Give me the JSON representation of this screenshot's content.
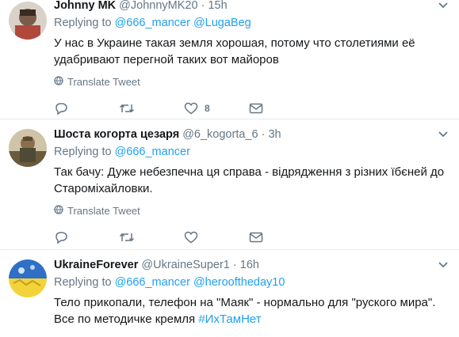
{
  "tweets": [
    {
      "name": "Johnny MK",
      "handle": "@JohnnyMK20",
      "dot": "·",
      "time": "15h",
      "replying_label": "Replying to",
      "replying_to": [
        "@666_mancer",
        "@LugaBeg"
      ],
      "text": "У нас в Украине такая земля хорошая, потому что столетиями её удабривают перегной таких вот майоров",
      "hashtag": "",
      "translate": "Translate Tweet",
      "likes": "8"
    },
    {
      "name": "Шоста когорта цезаря",
      "handle": "@6_kogorta_6",
      "dot": "·",
      "time": "3h",
      "replying_label": "Replying to",
      "replying_to": [
        "@666_mancer"
      ],
      "text": "Так бачу: Дуже небезпечна ця справа - відрядження з різних їбєней до Староміхайловки.",
      "hashtag": "",
      "translate": "Translate Tweet",
      "likes": ""
    },
    {
      "name": "UkraineForever",
      "handle": "@UkraineSuper1",
      "dot": "·",
      "time": "16h",
      "replying_label": "Replying to",
      "replying_to": [
        "@666_mancer",
        "@heroo​ftheday10"
      ],
      "text": "Тело прикопали, телефон на \"Маяк\" - нормально для \"руского мира\". Все по методичке кремля",
      "hashtag": "#ИхТамНет",
      "translate": "",
      "likes": ""
    }
  ],
  "icons": {
    "reply": "reply-icon",
    "retweet": "retweet-icon",
    "like": "heart-icon",
    "dm": "envelope-icon",
    "globe": "globe-icon",
    "caret": "chevron-down-icon"
  },
  "colors": {
    "link": "#1da1f2",
    "muted": "#657786",
    "text": "#14171a",
    "divider": "#e6ecf0"
  }
}
